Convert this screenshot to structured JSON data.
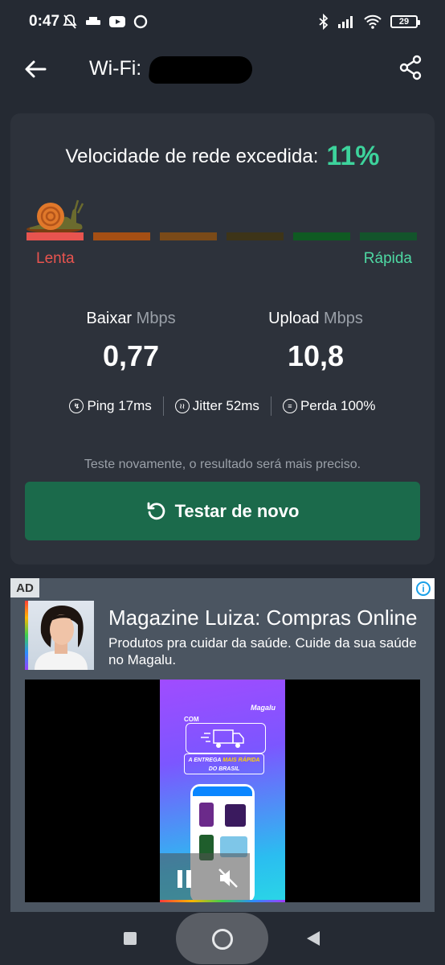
{
  "status_bar": {
    "time": "0:47",
    "battery": "29",
    "left_icons": [
      "muted-bell-icon",
      "tray-icon",
      "youtube-icon",
      "ring-icon"
    ],
    "right_icons": [
      "bluetooth-icon",
      "signal-icon",
      "wifi-icon",
      "battery-icon"
    ]
  },
  "toolbar": {
    "title": "Wi-Fi: "
  },
  "result": {
    "exceeded_label": "Velocidade de rede excedida:",
    "exceeded_percent": "11%",
    "scale_slow_label": "Lenta",
    "scale_fast_label": "Rápida",
    "scale_colors": [
      "#e8544f",
      "#a54f14",
      "#7a4a18",
      "#3d3418",
      "#0f5a22",
      "#13542b"
    ],
    "download": {
      "label": "Baixar",
      "unit": "Mbps",
      "value": "0,77"
    },
    "upload": {
      "label": "Upload",
      "unit": "Mbps",
      "value": "10,8"
    },
    "ping": "Ping 17ms",
    "jitter": "Jitter 52ms",
    "loss": "Perda 100%",
    "hint": "Teste novamente, o resultado será mais preciso.",
    "retest_label": "Testar de novo",
    "accent_color": "#3dd39c"
  },
  "ad": {
    "badge": "AD",
    "title": "Magazine Luiza: Compras Online",
    "description": "Produtos pra cuidar da saúde. Cuide da sua saúde no Magalu.",
    "creative_brand": "Magalu",
    "creative_com": "COM",
    "creative_tag_line1": "A ENTREGA",
    "creative_tag_highlight": "MAIS RÁPIDA",
    "creative_tag_line2": "DO BRASIL"
  }
}
